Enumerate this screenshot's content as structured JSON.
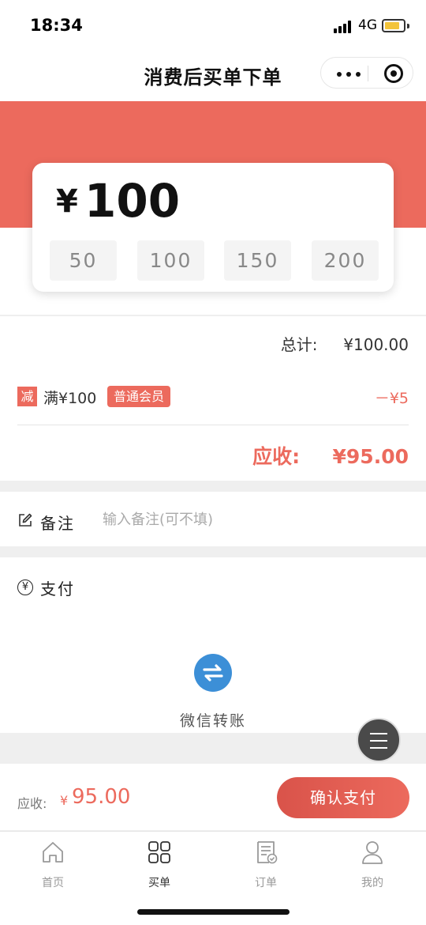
{
  "status_bar": {
    "time": "18:34",
    "network": "4G"
  },
  "nav": {
    "title": "消费后买单下单"
  },
  "amount": {
    "currency": "¥",
    "value": "100",
    "presets": [
      "50",
      "100",
      "150",
      "200"
    ]
  },
  "summary": {
    "total_label": "总计:",
    "total_value": "¥100.00",
    "discount_badge": "减",
    "discount_text": "满¥100",
    "member_tag": "普通会员",
    "discount_amount": "－¥5",
    "due_label": "应收:",
    "due_value": "¥95.00"
  },
  "note": {
    "label": "备注",
    "placeholder": "输入备注(可不填)"
  },
  "payment": {
    "label": "支付",
    "method_label": "微信转账"
  },
  "bottom_bar": {
    "due_label": "应收:",
    "currency": "¥",
    "due_amount": "95.00",
    "confirm_label": "确认支付"
  },
  "tabbar": {
    "items": [
      {
        "label": "首页",
        "icon": "home-icon"
      },
      {
        "label": "买单",
        "icon": "grid-icon"
      },
      {
        "label": "订单",
        "icon": "order-icon"
      },
      {
        "label": "我的",
        "icon": "user-icon"
      }
    ],
    "active": "买单"
  },
  "colors": {
    "accent": "#ec6a5d",
    "transfer_blue": "#3c8fd7"
  }
}
